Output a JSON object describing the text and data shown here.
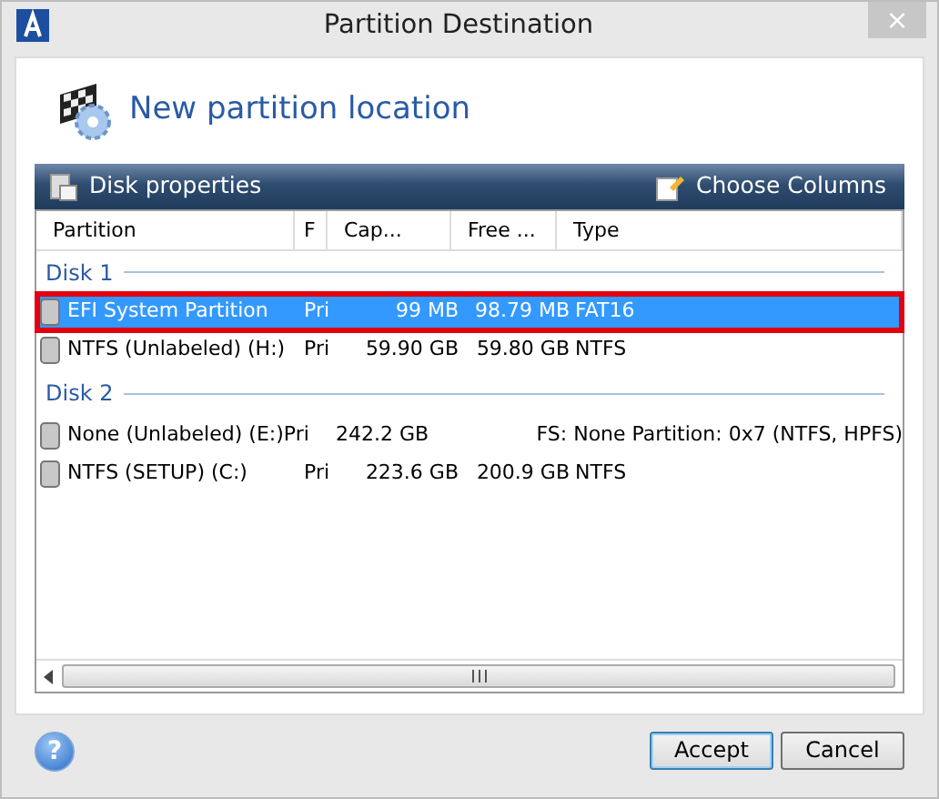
{
  "window": {
    "title": "Partition Destination",
    "close": "×"
  },
  "header": {
    "title": "New partition location"
  },
  "toolbar": {
    "left": "Disk properties",
    "right": "Choose Columns"
  },
  "table": {
    "columns": [
      "Partition",
      "F",
      "Cap...",
      "Free ...",
      "Type"
    ],
    "disks": [
      {
        "label": "Disk 1",
        "partitions": [
          {
            "cells": [
              "EFI System Partition",
              "Pri",
              "99 MB",
              "98.79 MB",
              "FAT16"
            ],
            "selected": true
          },
          {
            "cells": [
              "NTFS (Unlabeled) (H:)",
              "Pri",
              "59.90 GB",
              "59.80 GB",
              "NTFS"
            ],
            "selected": false
          }
        ]
      },
      {
        "label": "Disk 2",
        "partitions": [
          {
            "cells": [
              "None (Unlabeled) (E:)",
              "Pri",
              "242.2 GB",
              "",
              "FS: None Partition: 0x7 (NTFS, HPFS)"
            ],
            "selected": false
          },
          {
            "cells": [
              "NTFS (SETUP) (C:)",
              "Pri",
              "223.6 GB",
              "200.9 GB",
              "NTFS"
            ],
            "selected": false
          }
        ]
      }
    ]
  },
  "footer": {
    "help": "?",
    "buttons": [
      "Accept",
      "Cancel"
    ]
  }
}
